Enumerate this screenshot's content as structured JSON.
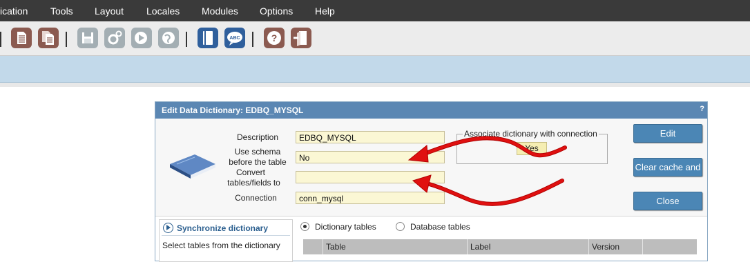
{
  "menu": [
    "ication",
    "Tools",
    "Layout",
    "Locales",
    "Modules",
    "Options",
    "Help"
  ],
  "toolbar_icons": [
    {
      "name": "new-document-icon",
      "color": "#8b5a50"
    },
    {
      "name": "copy-document-icon",
      "color": "#8b5a50"
    },
    {
      "name": "save-icon",
      "color": "#a3aeb3"
    },
    {
      "name": "gear-icon",
      "color": "#a3aeb3"
    },
    {
      "name": "run-icon",
      "color": "#a3aeb3"
    },
    {
      "name": "globe-icon",
      "color": "#a3aeb3"
    },
    {
      "name": "book-icon",
      "color": "#2f5f9c"
    },
    {
      "name": "spellcheck-icon",
      "color": "#2f5f9c"
    },
    {
      "name": "help-icon",
      "color": "#8b5a50"
    },
    {
      "name": "exit-icon",
      "color": "#8b5a50"
    }
  ],
  "dialog": {
    "title": "Edit Data Dictionary: EDBQ_MYSQL",
    "help": "?",
    "labels": {
      "description": "Description",
      "use_schema_1": "Use schema",
      "use_schema_2": "before the table",
      "convert_1": "Convert",
      "convert_2": "tables/fields to",
      "connection": "Connection"
    },
    "values": {
      "description": "EDBQ_MYSQL",
      "use_schema": "No",
      "convert": "",
      "connection": "conn_mysql"
    },
    "associate": {
      "legend": "Associate dictionary with connection",
      "value": "Yes"
    },
    "buttons": {
      "edit": "Edit",
      "clear_cache": "Clear cache and",
      "close": "Close"
    },
    "sync": {
      "title": "Synchronize dictionary",
      "desc": "Select tables from the dictionary"
    },
    "radios": {
      "dictionary_tables": "Dictionary tables",
      "database_tables": "Database tables"
    },
    "columns": [
      "",
      "Table",
      "Label",
      "Version",
      ""
    ]
  },
  "colors": {
    "menubar": "#3a3a3a",
    "dialog_title": "#5b87b3",
    "button": "#4b86b5",
    "field": "#fbf7d4",
    "arrow": "#e01010"
  }
}
